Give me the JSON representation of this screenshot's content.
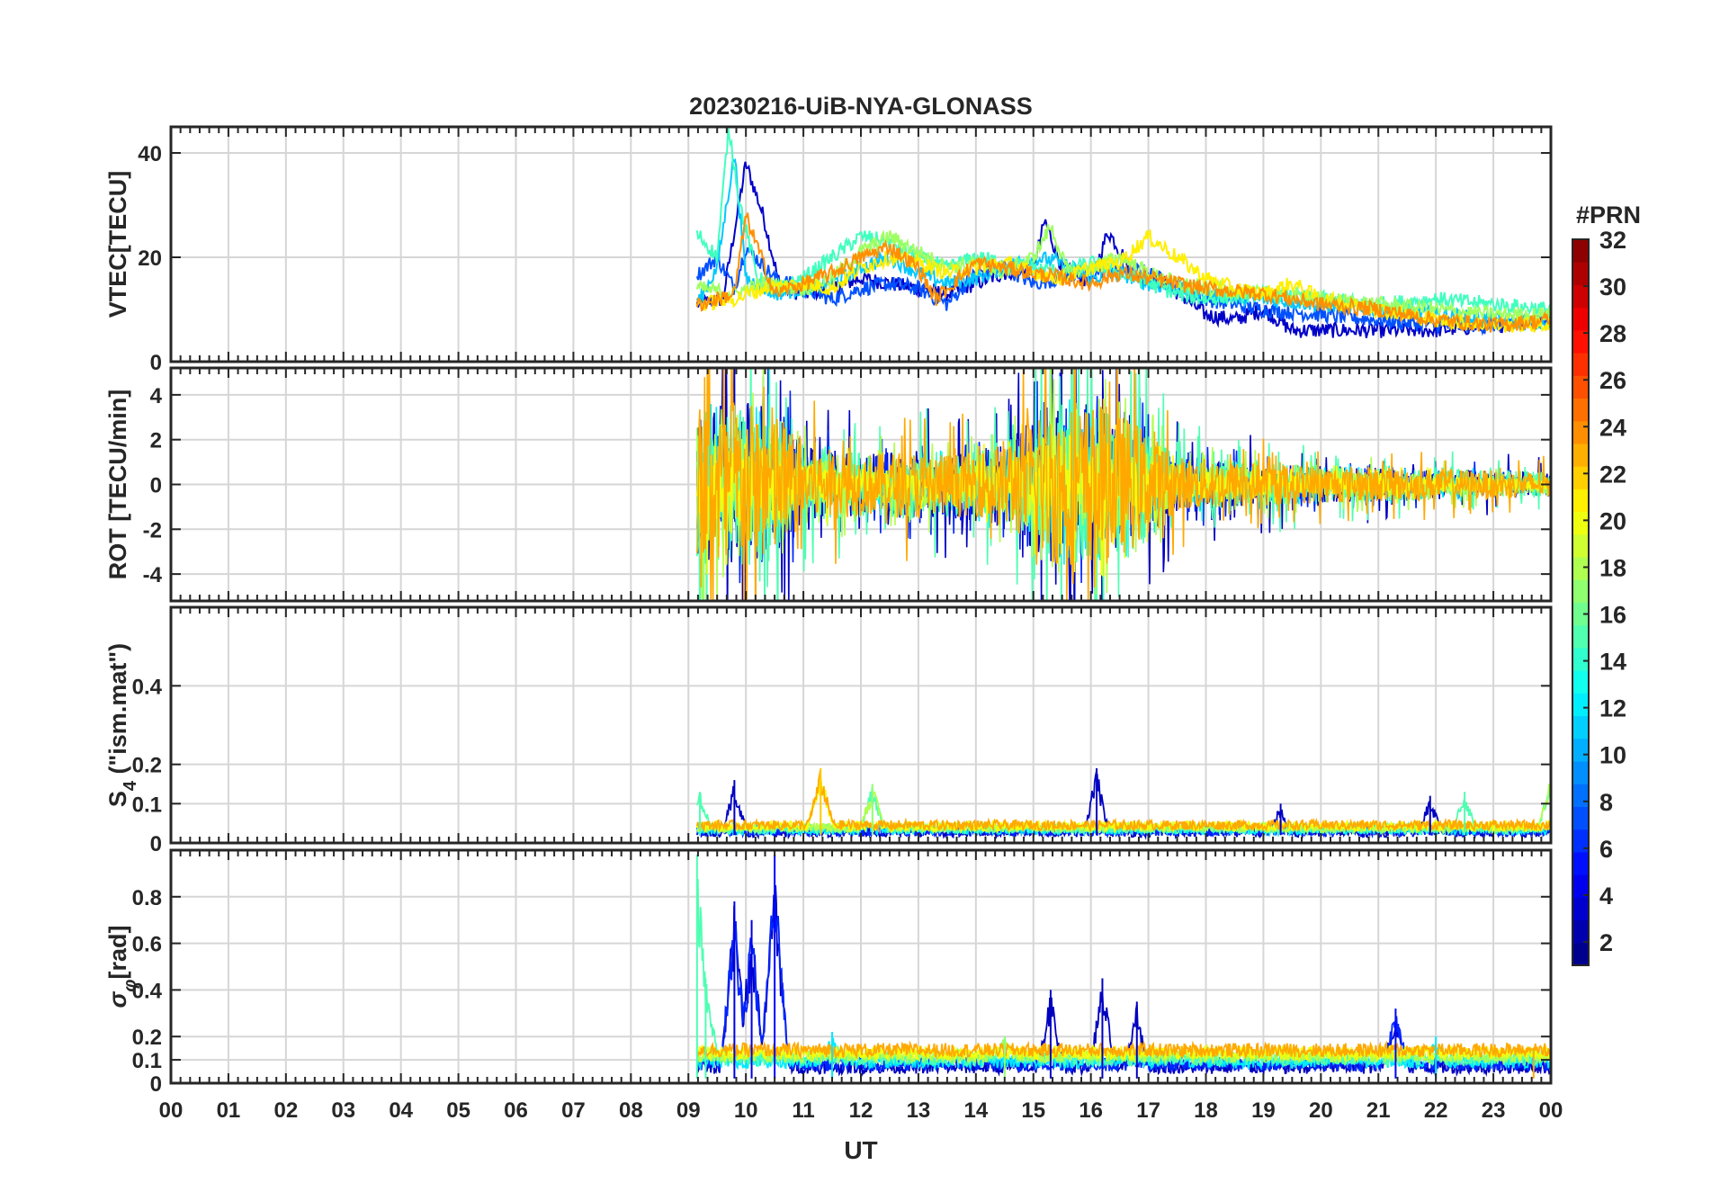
{
  "figure": {
    "title": "20230216-UiB-NYA-GLONASS",
    "xlabel": "UT",
    "x_ticks": [
      "00",
      "01",
      "02",
      "03",
      "04",
      "05",
      "06",
      "07",
      "08",
      "09",
      "10",
      "11",
      "12",
      "13",
      "14",
      "15",
      "16",
      "17",
      "18",
      "19",
      "20",
      "21",
      "22",
      "23",
      "00"
    ]
  },
  "colorbar": {
    "label": "#PRN",
    "min": 1,
    "max": 32,
    "ticks": [
      2,
      4,
      6,
      8,
      10,
      12,
      14,
      16,
      18,
      20,
      22,
      24,
      26,
      28,
      30,
      32
    ],
    "colormap": "jet",
    "levels": 32
  },
  "chart_data": [
    {
      "type": "line",
      "panel": "vtec",
      "ylabel": "VTEC[TECU]",
      "ylim": [
        0,
        45
      ],
      "yticks": [
        0,
        20,
        40
      ],
      "xlim_hours_ut": [
        0,
        24
      ],
      "grid": true,
      "data_start_ut_hour": 9.15,
      "data_end_ut_hour": 24,
      "series": [
        {
          "prn": 3,
          "color": "#0000c8",
          "x": [
            9.2,
            9.6,
            9.8,
            10.0,
            10.3,
            10.6,
            11.0,
            11.5,
            12.0,
            12.5,
            13.0,
            13.5,
            14.0,
            14.5,
            15.0,
            15.2,
            15.5,
            16.0,
            16.3,
            16.8,
            17.3,
            18.0,
            18.5,
            19.0,
            19.5,
            20.0,
            21.0,
            22.0,
            23.0,
            24.0
          ],
          "y": [
            11,
            12,
            25,
            38,
            28,
            14,
            13,
            14,
            16,
            15,
            14,
            13,
            15,
            17,
            18,
            27,
            18,
            15,
            25,
            16,
            15,
            9,
            8,
            10,
            6,
            6,
            6,
            6,
            7,
            8
          ]
        },
        {
          "prn": 6,
          "color": "#0050ff",
          "x": [
            9.2,
            9.5,
            9.8,
            10.0,
            10.5,
            11.0,
            11.5,
            12.0,
            12.5,
            13.0,
            13.5,
            14.0,
            14.5,
            15.0,
            15.5,
            16.0,
            16.5,
            17.0,
            17.5,
            18.0,
            19.0,
            20.0,
            21.0,
            22.0,
            23.0,
            24.0
          ],
          "y": [
            17,
            20,
            14,
            22,
            16,
            14,
            12,
            14,
            15,
            14,
            11,
            17,
            18,
            15,
            16,
            17,
            18,
            17,
            14,
            12,
            10,
            9,
            8,
            7,
            7,
            8
          ]
        },
        {
          "prn": 12,
          "color": "#00c8ff",
          "x": [
            9.2,
            9.5,
            9.8,
            10.0,
            10.5,
            11.0,
            11.5,
            12.0,
            12.5,
            13.0,
            13.5,
            14.0,
            14.5,
            15.0,
            15.5,
            16.0,
            16.5,
            17.0,
            17.5,
            18.0,
            19.0,
            20.0,
            21.0,
            22.0,
            23.0,
            24.0
          ],
          "y": [
            12,
            18,
            40,
            16,
            13,
            14,
            15,
            18,
            20,
            17,
            15,
            16,
            18,
            20,
            19,
            16,
            17,
            15,
            14,
            13,
            12,
            11,
            10,
            9,
            8,
            7
          ]
        },
        {
          "prn": 15,
          "color": "#40ffbf",
          "x": [
            9.2,
            9.5,
            9.7,
            9.9,
            10.2,
            10.6,
            11.0,
            11.5,
            12.0,
            12.5,
            13.0,
            13.5,
            14.0,
            14.5,
            15.0,
            15.5,
            16.0,
            16.5,
            17.0,
            17.5,
            18.0,
            19.0,
            20.0,
            21.0,
            22.0,
            23.0,
            24.0
          ],
          "y": [
            24,
            20,
            45,
            30,
            16,
            14,
            16,
            20,
            24,
            23,
            20,
            18,
            20,
            19,
            18,
            17,
            19,
            17,
            15,
            13,
            12,
            13,
            12,
            11,
            12,
            11,
            10
          ]
        },
        {
          "prn": 18,
          "color": "#9fff60",
          "x": [
            9.2,
            9.8,
            10.3,
            11.0,
            11.5,
            12.0,
            12.5,
            13.0,
            13.5,
            14.0,
            14.5,
            15.0,
            15.3,
            15.6,
            16.0,
            16.5,
            17.0,
            17.5,
            18.0,
            19.0,
            20.0,
            21.0,
            22.0,
            23.0,
            24.0
          ],
          "y": [
            14,
            13,
            15,
            14,
            16,
            21,
            24,
            21,
            18,
            19,
            17,
            20,
            26,
            17,
            18,
            20,
            17,
            15,
            14,
            13,
            12,
            11,
            10,
            9,
            9
          ]
        },
        {
          "prn": 20,
          "color": "#ffef00",
          "x": [
            9.2,
            9.8,
            10.3,
            11.0,
            11.5,
            12.0,
            12.5,
            13.0,
            13.5,
            14.0,
            14.5,
            15.0,
            15.5,
            16.0,
            16.5,
            17.0,
            17.5,
            18.0,
            18.5,
            19.0,
            19.5,
            20.0,
            21.0,
            22.0,
            23.0,
            24.0
          ],
          "y": [
            11,
            12,
            14,
            15,
            14,
            18,
            20,
            19,
            17,
            18,
            19,
            17,
            16,
            18,
            19,
            24,
            20,
            16,
            14,
            13,
            15,
            12,
            10,
            8,
            7,
            7
          ]
        },
        {
          "prn": 23,
          "color": "#ff8f00",
          "x": [
            9.2,
            9.8,
            10.0,
            10.5,
            11.0,
            11.5,
            12.0,
            12.5,
            13.0,
            13.3,
            13.6,
            14.0,
            14.5,
            15.0,
            15.5,
            16.0,
            16.5,
            17.0,
            17.5,
            18.0,
            19.0,
            20.0,
            21.0,
            22.0,
            23.0,
            24.0
          ],
          "y": [
            11,
            13,
            28,
            13,
            15,
            17,
            20,
            22,
            18,
            12,
            15,
            19,
            18,
            17,
            16,
            15,
            17,
            16,
            15,
            14,
            13,
            11,
            10,
            8,
            7,
            8
          ]
        }
      ]
    },
    {
      "type": "line",
      "panel": "rot",
      "ylabel": "ROT [TECU/min]",
      "ylim": [
        -5.2,
        5.2
      ],
      "yticks": [
        -4,
        -2,
        0,
        2,
        4
      ],
      "xlim_hours_ut": [
        0,
        24
      ],
      "grid": true,
      "data_start_ut_hour": 9.15,
      "amplitude_envelope": {
        "x": [
          9.15,
          9.5,
          10.0,
          10.5,
          11.0,
          12.0,
          13.0,
          14.0,
          14.8,
          15.2,
          15.6,
          16.2,
          16.8,
          17.5,
          18.5,
          20.0,
          22.0,
          24.0
        ],
        "y": [
          5.2,
          5.2,
          5.2,
          5.2,
          2.5,
          2.0,
          2.2,
          2.0,
          3.5,
          5.2,
          5.2,
          5.2,
          4.0,
          1.8,
          1.5,
          1.2,
          1.0,
          0.8
        ]
      },
      "series_prns": [
        3,
        6,
        12,
        15,
        18,
        20,
        23
      ]
    },
    {
      "type": "line",
      "panel": "s4",
      "ylabel": "S4 (\"ism.mat\")",
      "ylim": [
        0,
        0.6
      ],
      "yticks": [
        0,
        0.1,
        0.2,
        0.4
      ],
      "xlim_hours_ut": [
        0,
        24
      ],
      "grid": true,
      "data_start_ut_hour": 9.15,
      "baseline": 0.02,
      "peaks": [
        {
          "x": 9.2,
          "y": 0.13,
          "prn": 15
        },
        {
          "x": 9.8,
          "y": 0.16,
          "prn": 3
        },
        {
          "x": 11.3,
          "y": 0.19,
          "prn": 22
        },
        {
          "x": 12.2,
          "y": 0.15,
          "prn": 17
        },
        {
          "x": 16.1,
          "y": 0.19,
          "prn": 3
        },
        {
          "x": 19.3,
          "y": 0.1,
          "prn": 3
        },
        {
          "x": 21.9,
          "y": 0.12,
          "prn": 3
        },
        {
          "x": 22.5,
          "y": 0.13,
          "prn": 15
        },
        {
          "x": 24.0,
          "y": 0.18,
          "prn": 17
        }
      ],
      "series_prns": [
        3,
        6,
        12,
        15,
        18,
        20,
        23
      ]
    },
    {
      "type": "line",
      "panel": "sigma_phi",
      "ylabel": "σφ[rad]",
      "ylim": [
        0,
        1.0
      ],
      "yticks": [
        0,
        0.1,
        0.2,
        0.4,
        0.6,
        0.8
      ],
      "xlim_hours_ut": [
        0,
        24
      ],
      "grid": true,
      "data_start_ut_hour": 9.15,
      "peaks": [
        {
          "x": 9.15,
          "y": 0.98,
          "prn": 15
        },
        {
          "x": 9.3,
          "y": 0.45,
          "prn": 15
        },
        {
          "x": 9.8,
          "y": 0.78,
          "prn": 4
        },
        {
          "x": 10.1,
          "y": 0.7,
          "prn": 4
        },
        {
          "x": 10.5,
          "y": 0.98,
          "prn": 5
        },
        {
          "x": 11.5,
          "y": 0.22,
          "prn": 12
        },
        {
          "x": 14.5,
          "y": 0.2,
          "prn": 17
        },
        {
          "x": 15.3,
          "y": 0.4,
          "prn": 3
        },
        {
          "x": 16.2,
          "y": 0.45,
          "prn": 3
        },
        {
          "x": 16.8,
          "y": 0.35,
          "prn": 3
        },
        {
          "x": 21.3,
          "y": 0.32,
          "prn": 5
        },
        {
          "x": 22.0,
          "y": 0.2,
          "prn": 12
        },
        {
          "x": 23.7,
          "y": 0.15,
          "prn": 23
        }
      ],
      "series_prns": [
        3,
        6,
        12,
        15,
        18,
        20,
        23
      ]
    }
  ]
}
